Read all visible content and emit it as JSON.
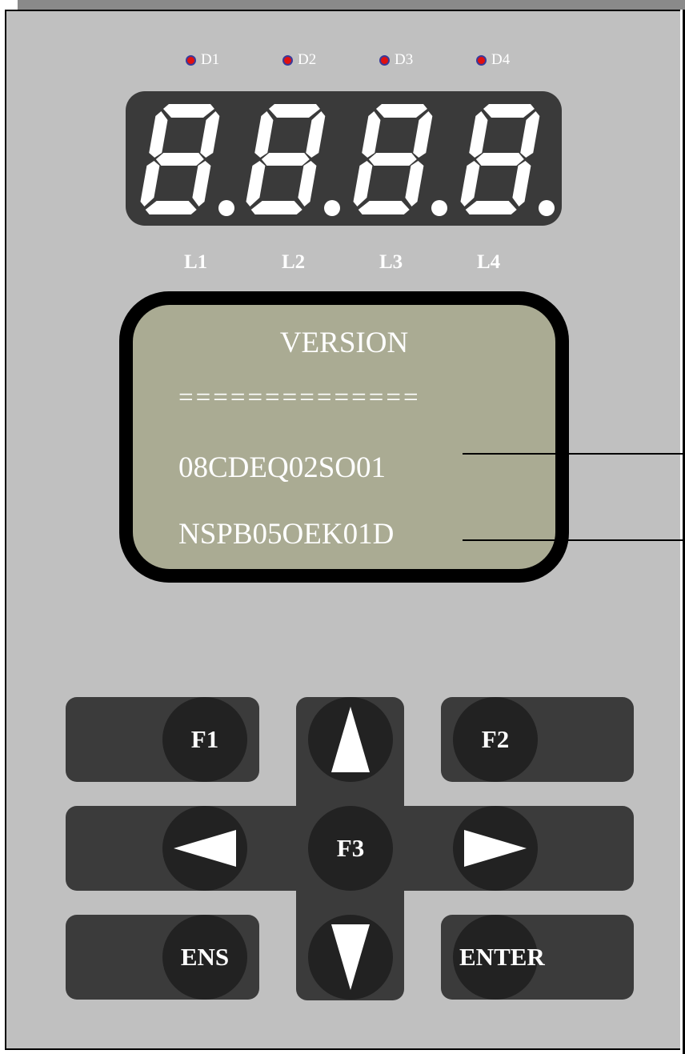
{
  "indicators": [
    {
      "label": "D1",
      "color": "#e01010"
    },
    {
      "label": "D2",
      "color": "#e01010"
    },
    {
      "label": "D3",
      "color": "#e01010"
    },
    {
      "label": "D4",
      "color": "#e01010"
    }
  ],
  "seven_segment": {
    "digits": 4,
    "all_segments_lit": true,
    "decimal_points_lit": true,
    "segment_color": "#ffffff",
    "background_color": "#3a3a3a"
  },
  "digit_labels": [
    "L1",
    "L2",
    "L3",
    "L4"
  ],
  "lcd": {
    "title": "VERSION",
    "separator": "==============",
    "line1": "08CDEQ02SO01",
    "line2": "NSPB05OEK01D",
    "background_color": "#aaab93"
  },
  "keys": {
    "f1": "F1",
    "f2": "F2",
    "f3": "F3",
    "up": "up-arrow-icon",
    "down": "down-arrow-icon",
    "left": "left-arrow-icon",
    "right": "right-arrow-icon",
    "ens": "ENS",
    "enter": "ENTER"
  }
}
